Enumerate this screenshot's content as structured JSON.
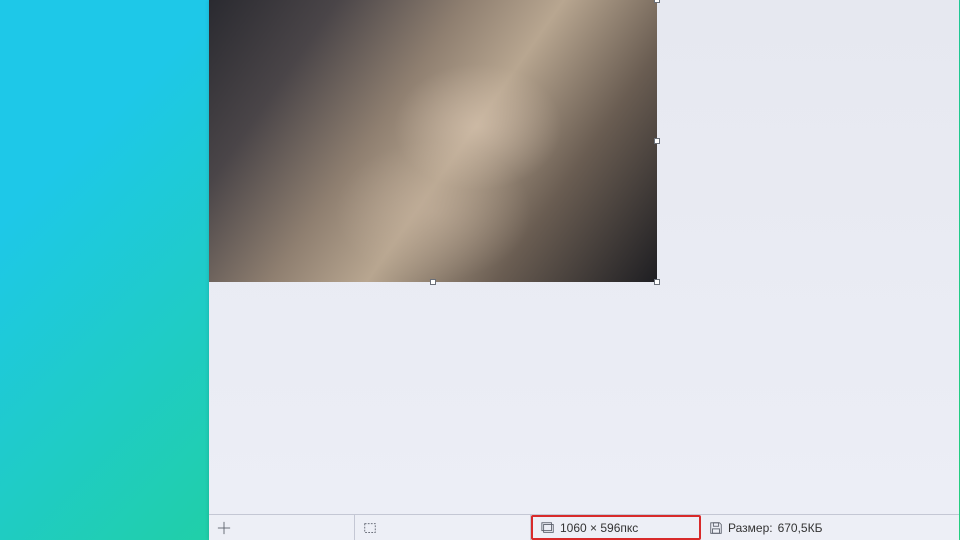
{
  "statusbar": {
    "dimensions": "1060 × 596пкс",
    "filesize_label": "Размер:",
    "filesize_value": "670,5КБ"
  }
}
